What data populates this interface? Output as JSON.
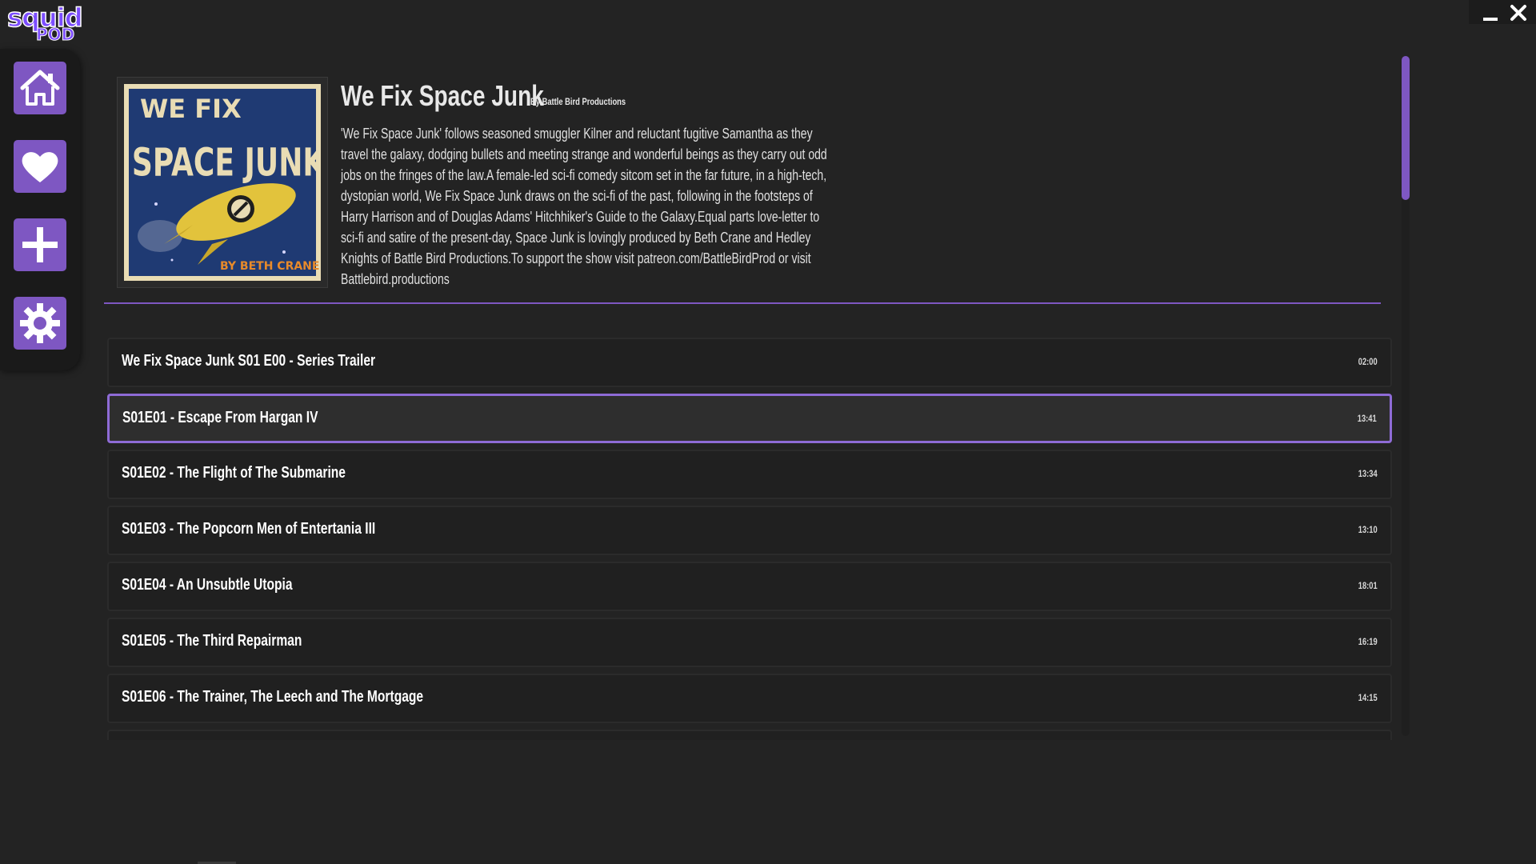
{
  "app": {
    "logo_top": "squid",
    "logo_bottom": "POD",
    "accent_color": "#7e57c2"
  },
  "window_controls": {
    "minimize_icon": "minimize-icon",
    "close_icon": "close-icon"
  },
  "sidebar": {
    "items": [
      {
        "name": "home",
        "icon": "home-icon"
      },
      {
        "name": "favorites",
        "icon": "heart-icon"
      },
      {
        "name": "add",
        "icon": "plus-icon"
      },
      {
        "name": "settings",
        "icon": "gear-icon"
      }
    ]
  },
  "podcast": {
    "title": "We Fix Space Junk",
    "author": "By Battle Bird Productions",
    "description": "'We Fix Space Junk' follows seasoned smuggler Kilner and reluctant fugitive Samantha as they travel the galaxy, dodging bullets and meeting strange and wonderful beings as they carry out odd jobs on the fringes of the law.A female-led sci-fi comedy sitcom set in the far future, in a high-tech, dystopian world, We Fix Space Junk draws on the sci-fi of the past, following in the footsteps of Harry Harrison and of Douglas Adams' Hitchhiker's Guide to the Galaxy.Equal parts love-letter to sci-fi and satire of the present-day, Space Junk is lovingly produced by Beth Crane and Hedley Knights of Battle Bird Productions.To support the show visit patreon.com/BattleBirdProd or visit Battlebird.productions",
    "cover": {
      "line1": "WE FIX",
      "line2": "SPACE JUNK",
      "credit": "BY BETH CRANE"
    }
  },
  "episodes": [
    {
      "title": "We Fix Space Junk S01 E00 - Series Trailer",
      "duration": "02:00",
      "active": false
    },
    {
      "title": "S01E01 - Escape From Hargan IV",
      "duration": "13:41",
      "active": true
    },
    {
      "title": "S01E02 - The Flight of The Submarine",
      "duration": "13:34",
      "active": false
    },
    {
      "title": "S01E03 - The Popcorn Men of Entertania III",
      "duration": "13:10",
      "active": false
    },
    {
      "title": "S01E04 - An Unsubtle Utopia",
      "duration": "18:01",
      "active": false
    },
    {
      "title": "S01E05 - The Third Repairman",
      "duration": "16:19",
      "active": false
    },
    {
      "title": "S01E06 - The Trainer, The Leech and The Mortgage",
      "duration": "14:15",
      "active": false
    },
    {
      "title": "",
      "duration": "",
      "active": false
    }
  ]
}
